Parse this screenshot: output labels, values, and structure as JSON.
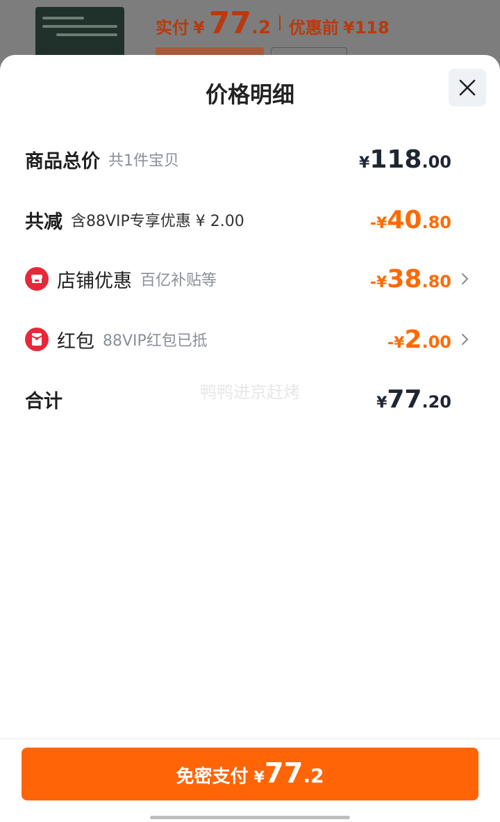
{
  "background": {
    "price_label": "实付",
    "currency": "¥",
    "price_int": "77",
    "price_dec": ".2",
    "original_label": "优惠前",
    "original_price": "¥118"
  },
  "sheet": {
    "title": "价格明细",
    "close_icon": "close-icon",
    "rows": {
      "total": {
        "label": "商品总价",
        "sub": "共1件宝贝",
        "cur": "¥",
        "int": "118",
        "dec": ".00"
      },
      "discount": {
        "label": "共减",
        "sub": "含88VIP专享优惠 ¥ 2.00",
        "cur": "-¥",
        "int": "40",
        "dec": ".80"
      },
      "store": {
        "label": "店铺优惠",
        "sub": "百亿补贴等",
        "cur": "-¥",
        "int": "38",
        "dec": ".80",
        "icon": "store-icon"
      },
      "redpacket": {
        "label": "红包",
        "sub": "88VIP红包已抵",
        "cur": "-¥",
        "int": "2",
        "dec": ".00",
        "icon": "red-packet-icon"
      },
      "sum": {
        "label": "合计",
        "cur": "¥",
        "int": "77",
        "dec": ".20"
      }
    },
    "watermark": "鸭鸭进京赶烤"
  },
  "pay_button": {
    "label": "免密支付",
    "cur": "¥",
    "int": "77",
    "dec": ".2"
  },
  "colors": {
    "accent": "#ff6407",
    "discount": "#ff6a00",
    "icon_red": "#e8283a"
  }
}
